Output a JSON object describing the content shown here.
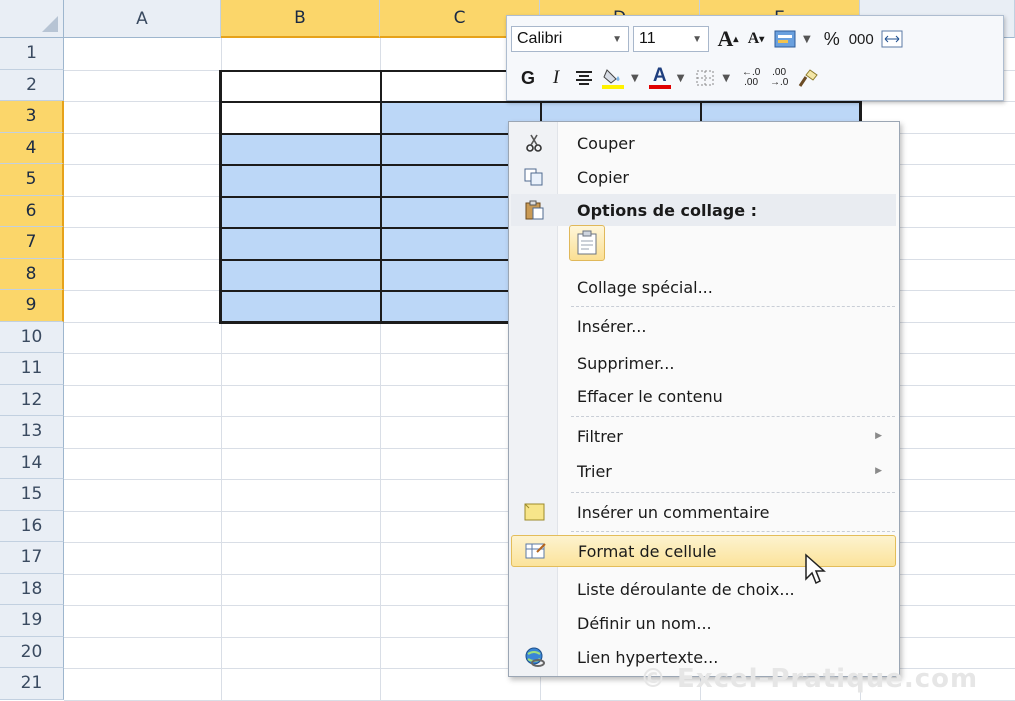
{
  "sheet": {
    "columns": [
      "A",
      "B",
      "C",
      "D",
      "E"
    ],
    "rows": [
      "1",
      "2",
      "3",
      "4",
      "5",
      "6",
      "7",
      "8",
      "9",
      "10",
      "11",
      "12",
      "13",
      "14",
      "15",
      "16",
      "17",
      "18",
      "19",
      "20",
      "21"
    ],
    "selected_columns": [
      "B",
      "C",
      "D",
      "E"
    ],
    "selected_rows": [
      "3",
      "4",
      "5",
      "6",
      "7",
      "8",
      "9"
    ],
    "selection_color": "#bcd7f7",
    "header_highlight_color": "#fbd66a"
  },
  "mini_toolbar": {
    "font_name": "Calibri",
    "font_size": "11",
    "grow_font": "A",
    "shrink_font": "A",
    "percent": "%",
    "thousands": "000",
    "bold": "G",
    "italic": "I"
  },
  "context_menu": {
    "items": [
      {
        "id": "cut",
        "label": "Couper",
        "icon": "scissors-icon"
      },
      {
        "id": "copy",
        "label": "Copier",
        "icon": "copy-icon"
      },
      {
        "id": "paste-options",
        "label": "Options de collage :",
        "icon": "paste-icon"
      },
      {
        "id": "paste-special",
        "label": "Collage spécial..."
      },
      {
        "id": "insert",
        "label": "Insérer..."
      },
      {
        "id": "delete",
        "label": "Supprimer..."
      },
      {
        "id": "clear",
        "label": "Effacer le contenu"
      },
      {
        "id": "filter",
        "label": "Filtrer",
        "submenu": true
      },
      {
        "id": "sort",
        "label": "Trier",
        "submenu": true
      },
      {
        "id": "insert-comment",
        "label": "Insérer un commentaire",
        "icon": "comment-icon"
      },
      {
        "id": "format-cells",
        "label": "Format de cellule",
        "icon": "format-cells-icon",
        "hovered": true
      },
      {
        "id": "dropdown-list",
        "label": "Liste déroulante de choix..."
      },
      {
        "id": "define-name",
        "label": "Définir un nom..."
      },
      {
        "id": "hyperlink",
        "label": "Lien hypertexte...",
        "icon": "hyperlink-icon"
      }
    ]
  },
  "watermark": "© Excel-Pratique.com"
}
